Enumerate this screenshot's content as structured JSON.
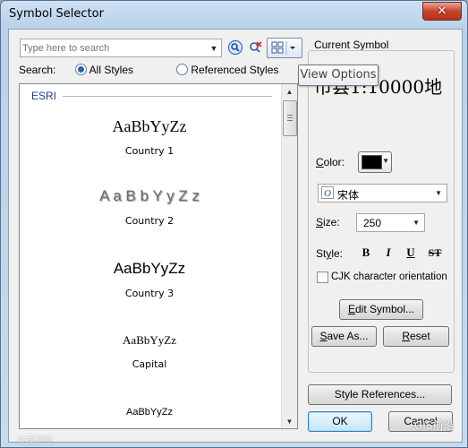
{
  "window": {
    "title": "Symbol Selector",
    "close_glyph": "✕"
  },
  "search": {
    "placeholder": "Type here to search",
    "scope_label": "Search:",
    "all_styles": "All Styles",
    "referenced_styles": "Referenced Styles",
    "selected_scope": "All Styles"
  },
  "tooltip": "View Options",
  "icons": {
    "search": "search-icon",
    "clear_search": "clear-search-icon",
    "view_options": "view-options-icon"
  },
  "symbol_list": {
    "group_title": "ESRI",
    "items": [
      {
        "sample": "AaBbYyZz",
        "label": "Country 1"
      },
      {
        "sample": "A a B b Y y Z z",
        "label": "Country 2"
      },
      {
        "sample": "AaBbYyZz",
        "label": "Country 3"
      },
      {
        "sample": "AaBbYyZz",
        "label": "Capital"
      },
      {
        "sample": "AaBbYyZz",
        "label": ""
      }
    ]
  },
  "current_symbol": {
    "heading": "Current Symbol",
    "preview_text": "市县1:10000地",
    "color_label": "Color:",
    "color_value": "#000000",
    "font_name": "宋体",
    "size_label": "Size:",
    "size_value": "250",
    "style_label": "Style:",
    "bold": "B",
    "italic": "I",
    "underline": "U",
    "strikethrough": "ST",
    "cjk_label": "CJK character orientation",
    "cjk_checked": false,
    "edit_symbol": "Edit Symbol...",
    "save_as": "Save As...",
    "reset": "Reset"
  },
  "footer": {
    "style_references": "Style References...",
    "ok": "OK",
    "cancel": "Cancel"
  },
  "watermarks": [
    "GIS前沿",
    "立成测量"
  ]
}
